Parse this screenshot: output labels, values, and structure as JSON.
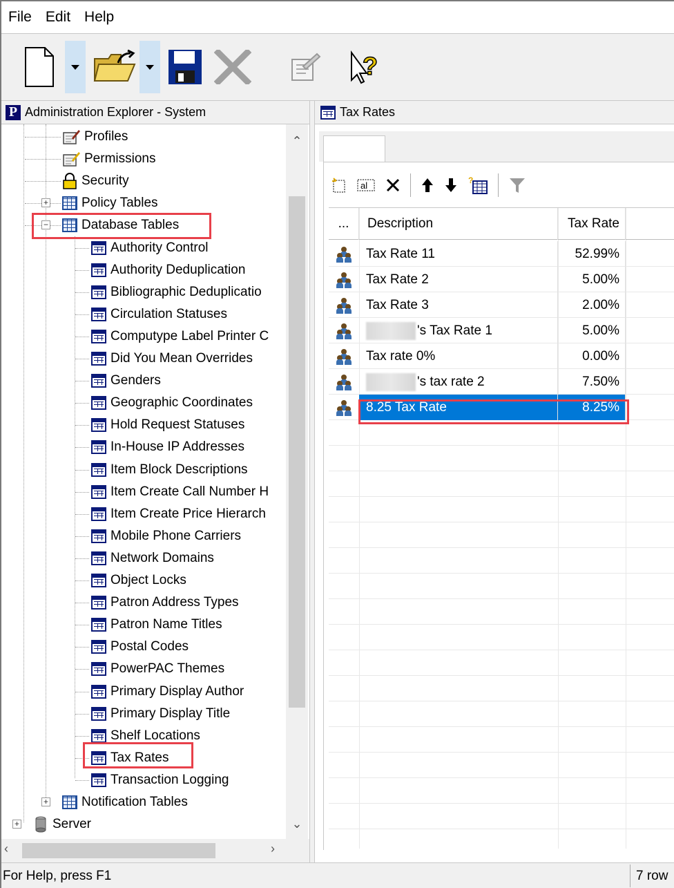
{
  "menu": [
    "File",
    "Edit",
    "Help"
  ],
  "left_pane": {
    "title": "Administration Explorer - System",
    "tree": [
      {
        "label": "Profiles",
        "icon": "profile-icon"
      },
      {
        "label": "Permissions",
        "icon": "permissions-icon"
      },
      {
        "label": "Security",
        "icon": "lock-icon"
      },
      {
        "label": "Policy Tables",
        "icon": "policy-table-icon"
      },
      {
        "label": "Database Tables",
        "icon": "database-table-icon"
      },
      {
        "label": "Authority Control"
      },
      {
        "label": "Authority Deduplication"
      },
      {
        "label": "Bibliographic Deduplicatio"
      },
      {
        "label": "Circulation Statuses"
      },
      {
        "label": "Computype Label Printer C"
      },
      {
        "label": "Did You Mean Overrides"
      },
      {
        "label": "Genders"
      },
      {
        "label": "Geographic Coordinates"
      },
      {
        "label": "Hold Request Statuses"
      },
      {
        "label": "In-House IP Addresses"
      },
      {
        "label": "Item Block Descriptions"
      },
      {
        "label": "Item Create Call Number H"
      },
      {
        "label": "Item Create Price Hierarch"
      },
      {
        "label": "Mobile Phone Carriers"
      },
      {
        "label": "Network Domains"
      },
      {
        "label": "Object Locks"
      },
      {
        "label": "Patron Address Types"
      },
      {
        "label": "Patron Name Titles"
      },
      {
        "label": "Postal Codes"
      },
      {
        "label": "PowerPAC Themes"
      },
      {
        "label": "Primary Display Author"
      },
      {
        "label": "Primary Display Title"
      },
      {
        "label": "Shelf Locations"
      },
      {
        "label": "Tax Rates"
      },
      {
        "label": "Transaction Logging"
      },
      {
        "label": "Notification Tables"
      },
      {
        "label": "Server"
      }
    ]
  },
  "right_pane": {
    "title": "Tax Rates",
    "grid": {
      "columns": [
        "...",
        "Description",
        "Tax Rate"
      ],
      "rows": [
        {
          "prefix": "",
          "description": "Tax Rate 11",
          "rate": "52.99%"
        },
        {
          "prefix": "",
          "description": "Tax Rate 2",
          "rate": "5.00%"
        },
        {
          "prefix": "",
          "description": "Tax Rate 3",
          "rate": "2.00%"
        },
        {
          "prefix": "redacted",
          "description": "'s Tax Rate 1",
          "rate": "5.00%"
        },
        {
          "prefix": "",
          "description": "Tax rate 0%",
          "rate": "0.00%"
        },
        {
          "prefix": "redacted",
          "description": "'s tax rate 2",
          "rate": "7.50%"
        },
        {
          "prefix": "",
          "description": "8.25 Tax Rate",
          "rate": "8.25%"
        }
      ],
      "selected_row": 6
    }
  },
  "status": {
    "help": "For Help, press F1",
    "rows": "7 row"
  },
  "colors": {
    "selection": "#0078d7",
    "highlight_box": "#e8404a"
  }
}
